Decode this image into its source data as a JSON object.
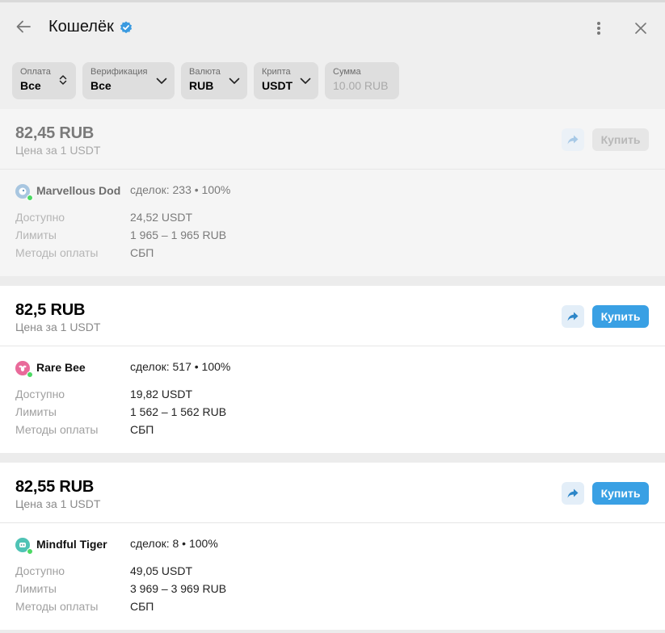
{
  "header": {
    "title": "Кошелёк"
  },
  "filters": [
    {
      "label": "Оплата",
      "value": "Все"
    },
    {
      "label": "Верификация",
      "value": "Все"
    },
    {
      "label": "Валюта",
      "value": "RUB"
    },
    {
      "label": "Крипта",
      "value": "USDT"
    },
    {
      "label": "Сумма",
      "placeholder": "10.00 RUB"
    }
  ],
  "labels": {
    "price_per": "Цена за 1 USDT",
    "available": "Доступно",
    "limits": "Лимиты",
    "methods": "Методы оплаты",
    "buy": "Купить"
  },
  "offers": [
    {
      "price": "82,45 RUB",
      "user": "Marvellous Dodo",
      "deals": "сделок: 233 • 100%",
      "available": "24,52 USDT",
      "limits": "1 965 – 1 965 RUB",
      "methods": "СБП",
      "disabled": true,
      "avatar_color": "#a8c6e0"
    },
    {
      "price": "82,5 RUB",
      "user": "Rare Bee",
      "deals": "сделок: 517 • 100%",
      "available": "19,82 USDT",
      "limits": "1 562 – 1 562 RUB",
      "methods": "СБП",
      "disabled": false,
      "avatar_color": "#e96a9a"
    },
    {
      "price": "82,55 RUB",
      "user": "Mindful Tiger",
      "deals": "сделок: 8 • 100%",
      "available": "49,05 USDT",
      "limits": "3 969 – 3 969 RUB",
      "methods": "СБП",
      "disabled": false,
      "avatar_color": "#4fc3b5"
    }
  ],
  "colors": {
    "accent": "#39a0e4",
    "online": "#4cd964",
    "verified": "#3a9ae0"
  }
}
